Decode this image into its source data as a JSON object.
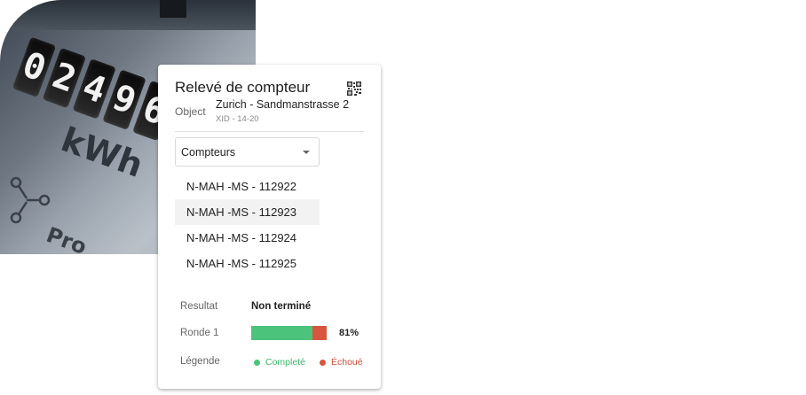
{
  "card": {
    "title": "Relevé de compteur",
    "object_label": "Object",
    "object_name": "Zurich - Sandmanstrasse 2",
    "object_id": "XID - 14-20"
  },
  "select": {
    "label": "Compteurs"
  },
  "menu": {
    "items": [
      "N-MAH -MS - 112922",
      "N-MAH -MS - 112923",
      "N-MAH -MS - 112924",
      "N-MAH -MS - 112925"
    ],
    "highlighted_index": 1
  },
  "result": {
    "label": "Resultat",
    "value": "Non terminé"
  },
  "round": {
    "label": "Ronde 1",
    "percent_text": "81%",
    "complete_fraction": 0.81,
    "failed_fraction": 0.19
  },
  "legend": {
    "label": "Légende",
    "complete": "Completé",
    "failed": "Échoué"
  },
  "photo": {
    "digits": [
      "0",
      "2",
      "4",
      "9",
      "6"
    ],
    "unit": "kWh",
    "partial_text": "Pro"
  },
  "colors": {
    "complete": "#4cc37a",
    "failed": "#d8553f",
    "complete_text": "#3fb56d",
    "failed_text": "#c9503b"
  },
  "icons": {
    "qr": "qr-code-icon",
    "caret": "caret-down-icon"
  }
}
